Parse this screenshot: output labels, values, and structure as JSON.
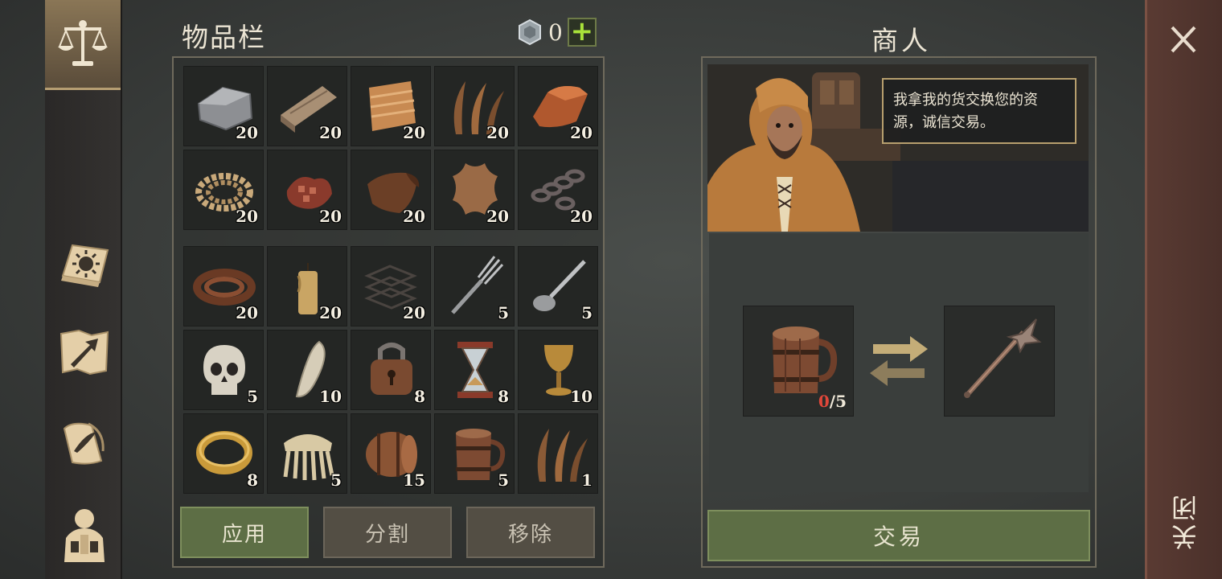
{
  "inventory": {
    "title": "物品栏",
    "coins": "0",
    "slots_top": [
      {
        "icon": "stone-icon",
        "count": "20"
      },
      {
        "icon": "wood-plank-icon",
        "count": "20"
      },
      {
        "icon": "fabric-icon",
        "count": "20"
      },
      {
        "icon": "plant-fiber-icon",
        "count": "20"
      },
      {
        "icon": "copper-ingot-icon",
        "count": "20"
      },
      {
        "icon": "rope-icon",
        "count": "20"
      },
      {
        "icon": "raw-meat-icon",
        "count": "20"
      },
      {
        "icon": "leather-icon",
        "count": "20"
      },
      {
        "icon": "hide-icon",
        "count": "20"
      },
      {
        "icon": "chain-icon",
        "count": "20"
      }
    ],
    "slots_bottom": [
      {
        "icon": "leather-strap-icon",
        "count": "20"
      },
      {
        "icon": "candle-icon",
        "count": "20"
      },
      {
        "icon": "wire-icon",
        "count": "20"
      },
      {
        "icon": "fork-icon",
        "count": "5"
      },
      {
        "icon": "spoon-icon",
        "count": "5"
      },
      {
        "icon": "skull-icon",
        "count": "5"
      },
      {
        "icon": "fang-icon",
        "count": "10"
      },
      {
        "icon": "padlock-icon",
        "count": "8"
      },
      {
        "icon": "hourglass-icon",
        "count": "8"
      },
      {
        "icon": "goblet-icon",
        "count": "10"
      },
      {
        "icon": "gold-ring-icon",
        "count": "8"
      },
      {
        "icon": "comb-icon",
        "count": "5"
      },
      {
        "icon": "barrel-icon",
        "count": "15"
      },
      {
        "icon": "mug-icon",
        "count": "5"
      },
      {
        "icon": "plant-fiber-icon",
        "count": "1"
      }
    ],
    "buttons": {
      "apply": "应用",
      "split": "分割",
      "remove": "移除"
    }
  },
  "merchant": {
    "title": "商人",
    "speech": "我拿我的货交换您的资源，诚信交易。",
    "give": {
      "icon": "mug-icon",
      "have": "0",
      "sep": "/",
      "need": "5"
    },
    "get": {
      "icon": "mace-spear-icon"
    },
    "trade_label": "交易"
  },
  "close": {
    "label": "关闭"
  },
  "colors": {
    "accent_green": "#5d6e45",
    "plus_green": "#a9e33a",
    "warning_red": "#e0473a"
  }
}
